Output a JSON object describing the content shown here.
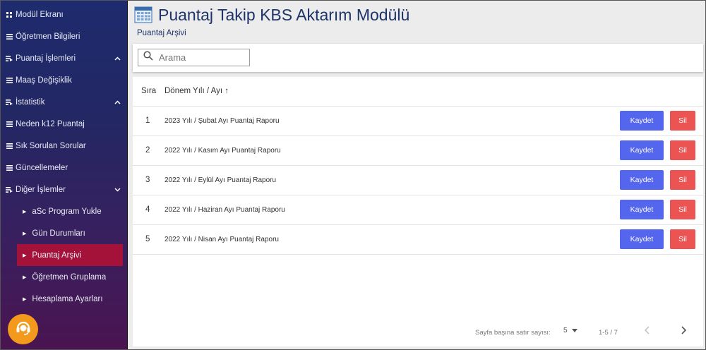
{
  "header": {
    "title": "Puantaj Takip KBS Aktarım Modülü",
    "breadcrumb": "Puantaj Arşivi"
  },
  "sidebar": {
    "items": [
      {
        "label": "Modül Ekranı",
        "icon": "grid-icon"
      },
      {
        "label": "Öğretmen Bilgileri",
        "icon": "list-icon"
      },
      {
        "label": "Puantaj İşlemleri",
        "icon": "playlist-icon",
        "chevron": "up"
      },
      {
        "label": "Maaş Değişiklik",
        "icon": "list-icon"
      },
      {
        "label": "İstatistik",
        "icon": "playlist-icon",
        "chevron": "up"
      },
      {
        "label": "Neden k12 Puantaj",
        "icon": "list-icon"
      },
      {
        "label": "Sık Sorulan Sorular",
        "icon": "list-icon"
      },
      {
        "label": "Güncellemeler",
        "icon": "list-icon"
      },
      {
        "label": "Diğer İşlemler",
        "icon": "playlist-icon",
        "chevron": "down"
      }
    ],
    "sub_items": [
      {
        "label": "aSc Program Yukle"
      },
      {
        "label": "Gün Durumları"
      },
      {
        "label": "Puantaj Arşivi",
        "active": true
      },
      {
        "label": "Öğretmen Gruplama"
      },
      {
        "label": "Hesaplama Ayarları"
      }
    ],
    "active_color": "#a4123a"
  },
  "search": {
    "placeholder": "Arama"
  },
  "table": {
    "columns": [
      "Sıra",
      "Dönem Yılı / Ayı"
    ],
    "sort_indicator": "↑",
    "save_label": "Kaydet",
    "delete_label": "Sil",
    "rows": [
      {
        "num": "1",
        "name": "2023 Yılı / Şubat Ayı Puantaj Raporu"
      },
      {
        "num": "2",
        "name": "2022 Yılı / Kasım Ayı Puantaj Raporu"
      },
      {
        "num": "3",
        "name": "2022 Yılı / Eylül Ayı Puantaj Raporu"
      },
      {
        "num": "4",
        "name": "2022 Yılı / Haziran Ayı Puantaj Raporu"
      },
      {
        "num": "5",
        "name": "2022 Yılı / Nisan Ayı Puantaj Raporu"
      }
    ]
  },
  "pagination": {
    "rows_per_page_label": "Sayfa başına satır sayısı:",
    "rows_per_page": "5",
    "range": "1-5 / 7",
    "prev_icon": "chevron-left-icon",
    "next_icon": "chevron-right-icon"
  },
  "colors": {
    "save_button": "#5566ee",
    "delete_button": "#ec5454",
    "title": "#1e3468",
    "support_button": "#f39a1d"
  }
}
